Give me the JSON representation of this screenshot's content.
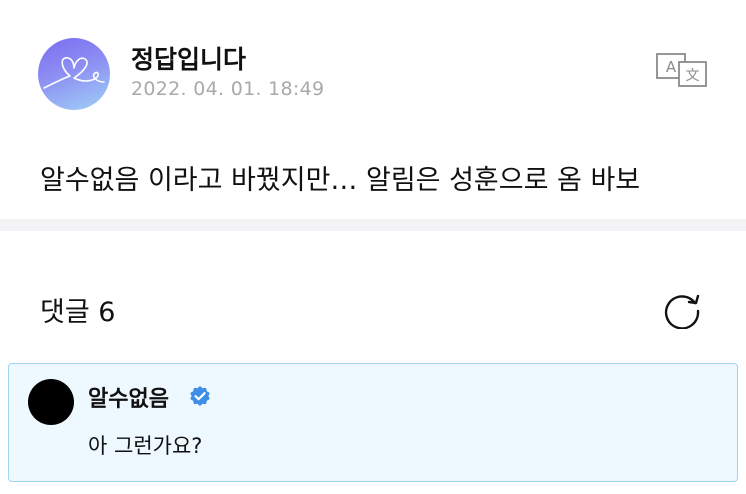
{
  "post": {
    "author": "정답입니다",
    "timestamp": "2022. 04. 01. 18:49",
    "body": "알수없음 이라고 바꿨지만… 알림은 성훈으로 옴 바보",
    "translate_icon": "translate-icon"
  },
  "comments": {
    "title": "댓글 6",
    "refresh_icon": "refresh-icon",
    "items": [
      {
        "author": "알수없음",
        "verified_icon": "verified-badge-icon",
        "text": "아 그런가요?"
      }
    ]
  },
  "colors": {
    "divider": "#f3f3f6",
    "comment_background": "#eef8ff",
    "comment_border": "#9fd4f6",
    "verified": "#3e8ee6",
    "timestamp": "#a9a9ad"
  }
}
